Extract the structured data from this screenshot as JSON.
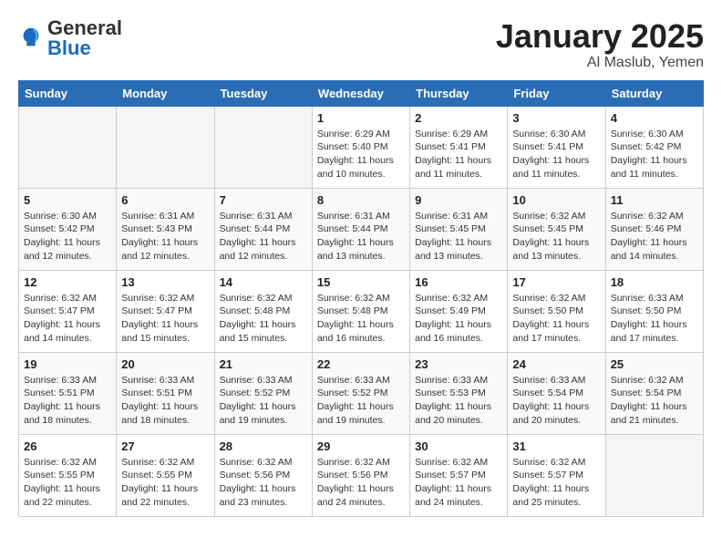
{
  "header": {
    "logo_general": "General",
    "logo_blue": "Blue",
    "title": "January 2025",
    "subtitle": "Al Maslub, Yemen"
  },
  "days_of_week": [
    "Sunday",
    "Monday",
    "Tuesday",
    "Wednesday",
    "Thursday",
    "Friday",
    "Saturday"
  ],
  "weeks": [
    [
      {
        "day": "",
        "info": ""
      },
      {
        "day": "",
        "info": ""
      },
      {
        "day": "",
        "info": ""
      },
      {
        "day": "1",
        "info": "Sunrise: 6:29 AM\nSunset: 5:40 PM\nDaylight: 11 hours\nand 10 minutes."
      },
      {
        "day": "2",
        "info": "Sunrise: 6:29 AM\nSunset: 5:41 PM\nDaylight: 11 hours\nand 11 minutes."
      },
      {
        "day": "3",
        "info": "Sunrise: 6:30 AM\nSunset: 5:41 PM\nDaylight: 11 hours\nand 11 minutes."
      },
      {
        "day": "4",
        "info": "Sunrise: 6:30 AM\nSunset: 5:42 PM\nDaylight: 11 hours\nand 11 minutes."
      }
    ],
    [
      {
        "day": "5",
        "info": "Sunrise: 6:30 AM\nSunset: 5:42 PM\nDaylight: 11 hours\nand 12 minutes."
      },
      {
        "day": "6",
        "info": "Sunrise: 6:31 AM\nSunset: 5:43 PM\nDaylight: 11 hours\nand 12 minutes."
      },
      {
        "day": "7",
        "info": "Sunrise: 6:31 AM\nSunset: 5:44 PM\nDaylight: 11 hours\nand 12 minutes."
      },
      {
        "day": "8",
        "info": "Sunrise: 6:31 AM\nSunset: 5:44 PM\nDaylight: 11 hours\nand 13 minutes."
      },
      {
        "day": "9",
        "info": "Sunrise: 6:31 AM\nSunset: 5:45 PM\nDaylight: 11 hours\nand 13 minutes."
      },
      {
        "day": "10",
        "info": "Sunrise: 6:32 AM\nSunset: 5:45 PM\nDaylight: 11 hours\nand 13 minutes."
      },
      {
        "day": "11",
        "info": "Sunrise: 6:32 AM\nSunset: 5:46 PM\nDaylight: 11 hours\nand 14 minutes."
      }
    ],
    [
      {
        "day": "12",
        "info": "Sunrise: 6:32 AM\nSunset: 5:47 PM\nDaylight: 11 hours\nand 14 minutes."
      },
      {
        "day": "13",
        "info": "Sunrise: 6:32 AM\nSunset: 5:47 PM\nDaylight: 11 hours\nand 15 minutes."
      },
      {
        "day": "14",
        "info": "Sunrise: 6:32 AM\nSunset: 5:48 PM\nDaylight: 11 hours\nand 15 minutes."
      },
      {
        "day": "15",
        "info": "Sunrise: 6:32 AM\nSunset: 5:48 PM\nDaylight: 11 hours\nand 16 minutes."
      },
      {
        "day": "16",
        "info": "Sunrise: 6:32 AM\nSunset: 5:49 PM\nDaylight: 11 hours\nand 16 minutes."
      },
      {
        "day": "17",
        "info": "Sunrise: 6:32 AM\nSunset: 5:50 PM\nDaylight: 11 hours\nand 17 minutes."
      },
      {
        "day": "18",
        "info": "Sunrise: 6:33 AM\nSunset: 5:50 PM\nDaylight: 11 hours\nand 17 minutes."
      }
    ],
    [
      {
        "day": "19",
        "info": "Sunrise: 6:33 AM\nSunset: 5:51 PM\nDaylight: 11 hours\nand 18 minutes."
      },
      {
        "day": "20",
        "info": "Sunrise: 6:33 AM\nSunset: 5:51 PM\nDaylight: 11 hours\nand 18 minutes."
      },
      {
        "day": "21",
        "info": "Sunrise: 6:33 AM\nSunset: 5:52 PM\nDaylight: 11 hours\nand 19 minutes."
      },
      {
        "day": "22",
        "info": "Sunrise: 6:33 AM\nSunset: 5:52 PM\nDaylight: 11 hours\nand 19 minutes."
      },
      {
        "day": "23",
        "info": "Sunrise: 6:33 AM\nSunset: 5:53 PM\nDaylight: 11 hours\nand 20 minutes."
      },
      {
        "day": "24",
        "info": "Sunrise: 6:33 AM\nSunset: 5:54 PM\nDaylight: 11 hours\nand 20 minutes."
      },
      {
        "day": "25",
        "info": "Sunrise: 6:32 AM\nSunset: 5:54 PM\nDaylight: 11 hours\nand 21 minutes."
      }
    ],
    [
      {
        "day": "26",
        "info": "Sunrise: 6:32 AM\nSunset: 5:55 PM\nDaylight: 11 hours\nand 22 minutes."
      },
      {
        "day": "27",
        "info": "Sunrise: 6:32 AM\nSunset: 5:55 PM\nDaylight: 11 hours\nand 22 minutes."
      },
      {
        "day": "28",
        "info": "Sunrise: 6:32 AM\nSunset: 5:56 PM\nDaylight: 11 hours\nand 23 minutes."
      },
      {
        "day": "29",
        "info": "Sunrise: 6:32 AM\nSunset: 5:56 PM\nDaylight: 11 hours\nand 24 minutes."
      },
      {
        "day": "30",
        "info": "Sunrise: 6:32 AM\nSunset: 5:57 PM\nDaylight: 11 hours\nand 24 minutes."
      },
      {
        "day": "31",
        "info": "Sunrise: 6:32 AM\nSunset: 5:57 PM\nDaylight: 11 hours\nand 25 minutes."
      },
      {
        "day": "",
        "info": ""
      }
    ]
  ]
}
